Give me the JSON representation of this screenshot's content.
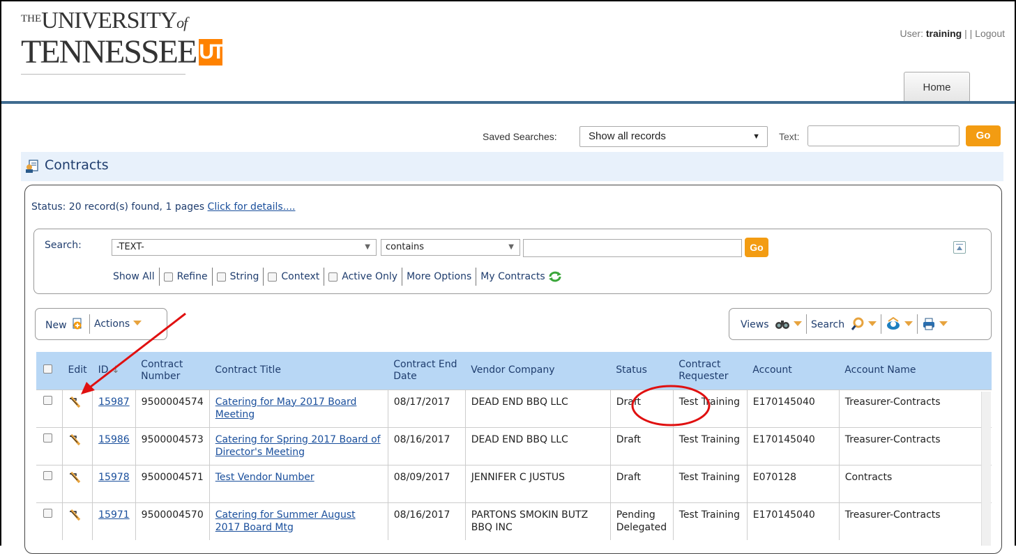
{
  "brand": {
    "logo_line1_prefix": "THE",
    "logo_line1_main": "UNIVERSITY",
    "logo_line1_suffix": "of",
    "logo_line2": "TENNESSEE",
    "logo_mark": "UT",
    "accent_color": "#FF8200"
  },
  "user": {
    "label": "User:",
    "name": "training",
    "separator": "| |",
    "logout": "Logout"
  },
  "tabs": {
    "home": "Home"
  },
  "saved_search": {
    "label": "Saved Searches:",
    "selected": "Show all records",
    "text_label": "Text:",
    "text_value": "",
    "go": "Go"
  },
  "contracts": {
    "title": "Contracts",
    "status_prefix": "Status:",
    "status_text": "20 record(s) found, 1 pages",
    "status_link": "Click for details...."
  },
  "search": {
    "label": "Search:",
    "field_selected": "-TEXT-",
    "operator_selected": "contains",
    "value": "",
    "go": "Go",
    "options": {
      "show_all": "Show All",
      "refine": "Refine",
      "string": "String",
      "context": "Context",
      "active_only": "Active Only",
      "more_options": "More Options",
      "my_contracts": "My Contracts"
    }
  },
  "toolbar": {
    "new": "New",
    "actions": "Actions",
    "views": "Views",
    "search": "Search"
  },
  "table": {
    "headers": {
      "edit": "Edit",
      "id": "ID",
      "id_sort": "↓",
      "contract_number": "Contract Number",
      "contract_title": "Contract Title",
      "end_date": "Contract End Date",
      "vendor": "Vendor Company",
      "status": "Status",
      "requester": "Contract Requester",
      "account": "Account",
      "account_name": "Account Name"
    },
    "rows": [
      {
        "id": "15987",
        "number": "9500004574",
        "title": "Catering for May 2017 Board Meeting",
        "end_date": "08/17/2017",
        "vendor": "DEAD END BBQ LLC",
        "status": "Draft",
        "requester": "Test Training",
        "account": "E170145040",
        "account_name": "Treasurer-Contracts"
      },
      {
        "id": "15986",
        "number": "9500004573",
        "title": "Catering for Spring 2017 Board of Director's Meeting",
        "end_date": "08/16/2017",
        "vendor": "DEAD END BBQ LLC",
        "status": "Draft",
        "requester": "Test Training",
        "account": "E170145040",
        "account_name": "Treasurer-Contracts"
      },
      {
        "id": "15978",
        "number": "9500004571",
        "title": "Test Vendor Number",
        "end_date": "08/09/2017",
        "vendor": "JENNIFER C JUSTUS",
        "status": "Draft",
        "requester": "Test Training",
        "account": "E070128",
        "account_name": "Contracts"
      },
      {
        "id": "15971",
        "number": "9500004570",
        "title": "Catering for Summer August 2017 Board Mtg",
        "end_date": "08/16/2017",
        "vendor": "PARTONS SMOKIN BUTZ BBQ INC",
        "status": "Pending Delegated",
        "requester": "Test Training",
        "account": "E170145040",
        "account_name": "Treasurer-Contracts"
      }
    ]
  },
  "annotations": {
    "arrow_color": "#E01010",
    "circle_color": "#E01010",
    "arrow_target": "edit-icon",
    "circle_target": "status-draft"
  }
}
